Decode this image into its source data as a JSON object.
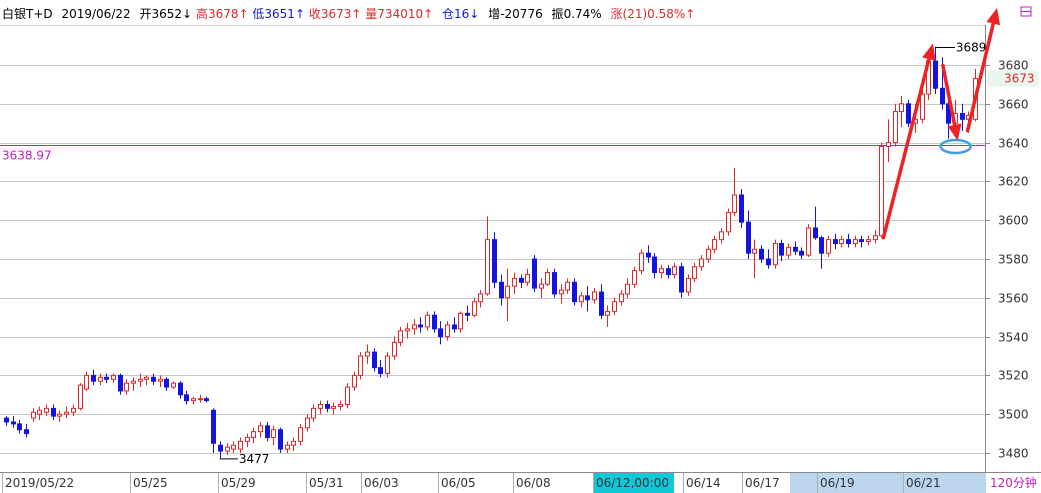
{
  "header": {
    "symbol": "白银T+D",
    "date": "2019/06/22",
    "open_label": "开",
    "open_value": "3652",
    "open_arrow": "↓",
    "high_label": "高",
    "high_value": "3678",
    "high_arrow": "↑",
    "low_label": "低",
    "low_value": "3651",
    "low_arrow": "↑",
    "close_label": "收",
    "close_value": "3673",
    "close_arrow": "↑",
    "volume_label": "量",
    "volume_value": "734010",
    "volume_arrow": "↑",
    "oi_label": "仓",
    "oi_value": "16",
    "oi_arrow": "↓",
    "increase_label": "增",
    "increase_value": "-20776",
    "amplitude_label": "振",
    "amplitude_value": "0.74%",
    "change_label": "涨",
    "change_value": "(21)0.58%",
    "change_arrow": "↑"
  },
  "colors": {
    "up": "#e0282a",
    "down": "#1414e0",
    "grid": "#c8c8c8",
    "ref_line": "#c020c0",
    "arrow": "#ee2222",
    "ellipse": "#3fa0e0",
    "axis_box": "#d6d6d6",
    "highlight_date_bg": "#10c8d8",
    "period_bg": "#bcd6ee"
  },
  "chart_data": {
    "type": "candlestick",
    "period": "120分钟",
    "y_ticks": [
      3480,
      3500,
      3520,
      3540,
      3560,
      3580,
      3600,
      3620,
      3640,
      3660,
      3680
    ],
    "ylim": [
      3470,
      3710
    ],
    "reference_value": "3638.97",
    "last_price": "3673",
    "max_label": "3689",
    "min_label": "3477",
    "x_labels": [
      "2019/05/22",
      "05/25",
      "05/29",
      "05/31",
      "06/03",
      "06/05",
      "06/08",
      "06/12,00:00",
      "06/14",
      "06/17",
      "06/19",
      "06/21"
    ],
    "highlighted_label": "06/12,00:00",
    "candles": [
      [
        3498,
        3499,
        3494,
        3496
      ],
      [
        3496,
        3499,
        3493,
        3495
      ],
      [
        3495,
        3497,
        3490,
        3492
      ],
      [
        3492,
        3495,
        3488,
        3490
      ],
      [
        3498,
        3503,
        3496,
        3501
      ],
      [
        3500,
        3504,
        3497,
        3502
      ],
      [
        3501,
        3505,
        3499,
        3503
      ],
      [
        3503,
        3505,
        3497,
        3499
      ],
      [
        3499,
        3502,
        3496,
        3500
      ],
      [
        3500,
        3504,
        3498,
        3501
      ],
      [
        3501,
        3505,
        3499,
        3503
      ],
      [
        3503,
        3516,
        3502,
        3515
      ],
      [
        3513,
        3522,
        3512,
        3520
      ],
      [
        3520,
        3523,
        3515,
        3517
      ],
      [
        3517,
        3521,
        3515,
        3519
      ],
      [
        3519,
        3521,
        3516,
        3518
      ],
      [
        3518,
        3521,
        3516,
        3520
      ],
      [
        3520,
        3521,
        3510,
        3512
      ],
      [
        3512,
        3518,
        3510,
        3516
      ],
      [
        3516,
        3519,
        3512,
        3517
      ],
      [
        3517,
        3521,
        3514,
        3518
      ],
      [
        3518,
        3520,
        3515,
        3519
      ],
      [
        3519,
        3521,
        3515,
        3517
      ],
      [
        3517,
        3520,
        3514,
        3518
      ],
      [
        3518,
        3519,
        3512,
        3514
      ],
      [
        3514,
        3517,
        3513,
        3516
      ],
      [
        3516,
        3517,
        3508,
        3510
      ],
      [
        3510,
        3512,
        3505,
        3507
      ],
      [
        3507,
        3509,
        3505,
        3508
      ],
      [
        3508,
        3510,
        3506,
        3508
      ],
      [
        3508,
        3509,
        3506,
        3507
      ],
      [
        3502,
        3503,
        3480,
        3485
      ],
      [
        3484,
        3486,
        3477,
        3481
      ],
      [
        3481,
        3485,
        3479,
        3483
      ],
      [
        3482,
        3486,
        3480,
        3484
      ],
      [
        3482,
        3488,
        3480,
        3486
      ],
      [
        3486,
        3490,
        3483,
        3488
      ],
      [
        3488,
        3493,
        3485,
        3491
      ],
      [
        3491,
        3496,
        3488,
        3494
      ],
      [
        3494,
        3496,
        3486,
        3488
      ],
      [
        3488,
        3494,
        3484,
        3492
      ],
      [
        3492,
        3493,
        3480,
        3482
      ],
      [
        3482,
        3486,
        3480,
        3484
      ],
      [
        3484,
        3488,
        3481,
        3486
      ],
      [
        3486,
        3495,
        3484,
        3493
      ],
      [
        3493,
        3500,
        3491,
        3498
      ],
      [
        3498,
        3505,
        3496,
        3503
      ],
      [
        3503,
        3507,
        3500,
        3505
      ],
      [
        3505,
        3507,
        3501,
        3503
      ],
      [
        3503,
        3506,
        3500,
        3504
      ],
      [
        3504,
        3507,
        3502,
        3505
      ],
      [
        3505,
        3516,
        3503,
        3514
      ],
      [
        3514,
        3522,
        3512,
        3520
      ],
      [
        3520,
        3532,
        3518,
        3530
      ],
      [
        3530,
        3536,
        3526,
        3532
      ],
      [
        3532,
        3534,
        3522,
        3524
      ],
      [
        3524,
        3528,
        3519,
        3521
      ],
      [
        3521,
        3532,
        3519,
        3530
      ],
      [
        3530,
        3540,
        3528,
        3537
      ],
      [
        3537,
        3545,
        3535,
        3543
      ],
      [
        3543,
        3547,
        3539,
        3544
      ],
      [
        3544,
        3549,
        3541,
        3546
      ],
      [
        3546,
        3550,
        3542,
        3545
      ],
      [
        3545,
        3553,
        3543,
        3551
      ],
      [
        3551,
        3553,
        3542,
        3544
      ],
      [
        3544,
        3548,
        3536,
        3540
      ],
      [
        3540,
        3548,
        3538,
        3546
      ],
      [
        3546,
        3550,
        3542,
        3544
      ],
      [
        3544,
        3553,
        3542,
        3552
      ],
      [
        3552,
        3556,
        3548,
        3551
      ],
      [
        3551,
        3560,
        3550,
        3558
      ],
      [
        3558,
        3564,
        3555,
        3562
      ],
      [
        3562,
        3602,
        3561,
        3590
      ],
      [
        3590,
        3594,
        3565,
        3568
      ],
      [
        3568,
        3572,
        3556,
        3560
      ],
      [
        3560,
        3575,
        3548,
        3566
      ],
      [
        3566,
        3573,
        3562,
        3570
      ],
      [
        3570,
        3572,
        3565,
        3568
      ],
      [
        3568,
        3575,
        3566,
        3572
      ],
      [
        3580,
        3582,
        3563,
        3565
      ],
      [
        3565,
        3570,
        3560,
        3567
      ],
      [
        3567,
        3575,
        3566,
        3573
      ],
      [
        3573,
        3575,
        3560,
        3562
      ],
      [
        3562,
        3567,
        3557,
        3564
      ],
      [
        3564,
        3570,
        3562,
        3568
      ],
      [
        3568,
        3570,
        3556,
        3558
      ],
      [
        3558,
        3563,
        3555,
        3561
      ],
      [
        3561,
        3566,
        3553,
        3559
      ],
      [
        3559,
        3565,
        3557,
        3563
      ],
      [
        3563,
        3567,
        3549,
        3551
      ],
      [
        3551,
        3556,
        3545,
        3553
      ],
      [
        3553,
        3560,
        3551,
        3558
      ],
      [
        3558,
        3564,
        3556,
        3562
      ],
      [
        3562,
        3570,
        3560,
        3567
      ],
      [
        3567,
        3576,
        3565,
        3574
      ],
      [
        3574,
        3585,
        3572,
        3583
      ],
      [
        3583,
        3587,
        3578,
        3581
      ],
      [
        3581,
        3583,
        3570,
        3573
      ],
      [
        3573,
        3577,
        3570,
        3575
      ],
      [
        3575,
        3577,
        3570,
        3572
      ],
      [
        3572,
        3578,
        3570,
        3576
      ],
      [
        3576,
        3578,
        3560,
        3563
      ],
      [
        3563,
        3572,
        3561,
        3570
      ],
      [
        3570,
        3578,
        3568,
        3576
      ],
      [
        3576,
        3582,
        3574,
        3580
      ],
      [
        3580,
        3587,
        3578,
        3585
      ],
      [
        3585,
        3592,
        3583,
        3590
      ],
      [
        3590,
        3596,
        3588,
        3594
      ],
      [
        3594,
        3606,
        3592,
        3604
      ],
      [
        3604,
        3627,
        3602,
        3613
      ],
      [
        3613,
        3616,
        3596,
        3599
      ],
      [
        3599,
        3605,
        3580,
        3583
      ],
      [
        3583,
        3590,
        3570,
        3585
      ],
      [
        3585,
        3587,
        3578,
        3580
      ],
      [
        3580,
        3585,
        3575,
        3577
      ],
      [
        3577,
        3590,
        3575,
        3588
      ],
      [
        3588,
        3590,
        3579,
        3582
      ],
      [
        3582,
        3588,
        3580,
        3586
      ],
      [
        3586,
        3589,
        3582,
        3584
      ],
      [
        3584,
        3586,
        3580,
        3582
      ],
      [
        3582,
        3598,
        3581,
        3596
      ],
      [
        3596,
        3607,
        3590,
        3591
      ],
      [
        3591,
        3592,
        3575,
        3583
      ],
      [
        3583,
        3592,
        3581,
        3590
      ],
      [
        3590,
        3593,
        3585,
        3588
      ],
      [
        3588,
        3592,
        3586,
        3590
      ],
      [
        3590,
        3593,
        3586,
        3588
      ],
      [
        3588,
        3592,
        3586,
        3590
      ],
      [
        3590,
        3592,
        3586,
        3589
      ],
      [
        3589,
        3592,
        3587,
        3590
      ],
      [
        3590,
        3595,
        3588,
        3592
      ],
      [
        3592,
        3640,
        3591,
        3638
      ],
      [
        3638,
        3652,
        3630,
        3640
      ],
      [
        3640,
        3660,
        3638,
        3656
      ],
      [
        3656,
        3664,
        3648,
        3660
      ],
      [
        3660,
        3662,
        3648,
        3650
      ],
      [
        3650,
        3660,
        3645,
        3652
      ],
      [
        3652,
        3668,
        3650,
        3665
      ],
      [
        3665,
        3685,
        3662,
        3682
      ],
      [
        3682,
        3689,
        3665,
        3668
      ],
      [
        3668,
        3684,
        3657,
        3660
      ],
      [
        3660,
        3666,
        3642,
        3650
      ],
      [
        3650,
        3662,
        3644,
        3655
      ],
      [
        3655,
        3660,
        3646,
        3652
      ],
      [
        3652,
        3656,
        3645,
        3654
      ],
      [
        3652,
        3678,
        3651,
        3673
      ]
    ]
  },
  "annotations": {
    "arrows": "red trend arrows: up from breakout, down into pullback, up from pullback",
    "ellipse": "circle marking the pullback low near 3640"
  }
}
